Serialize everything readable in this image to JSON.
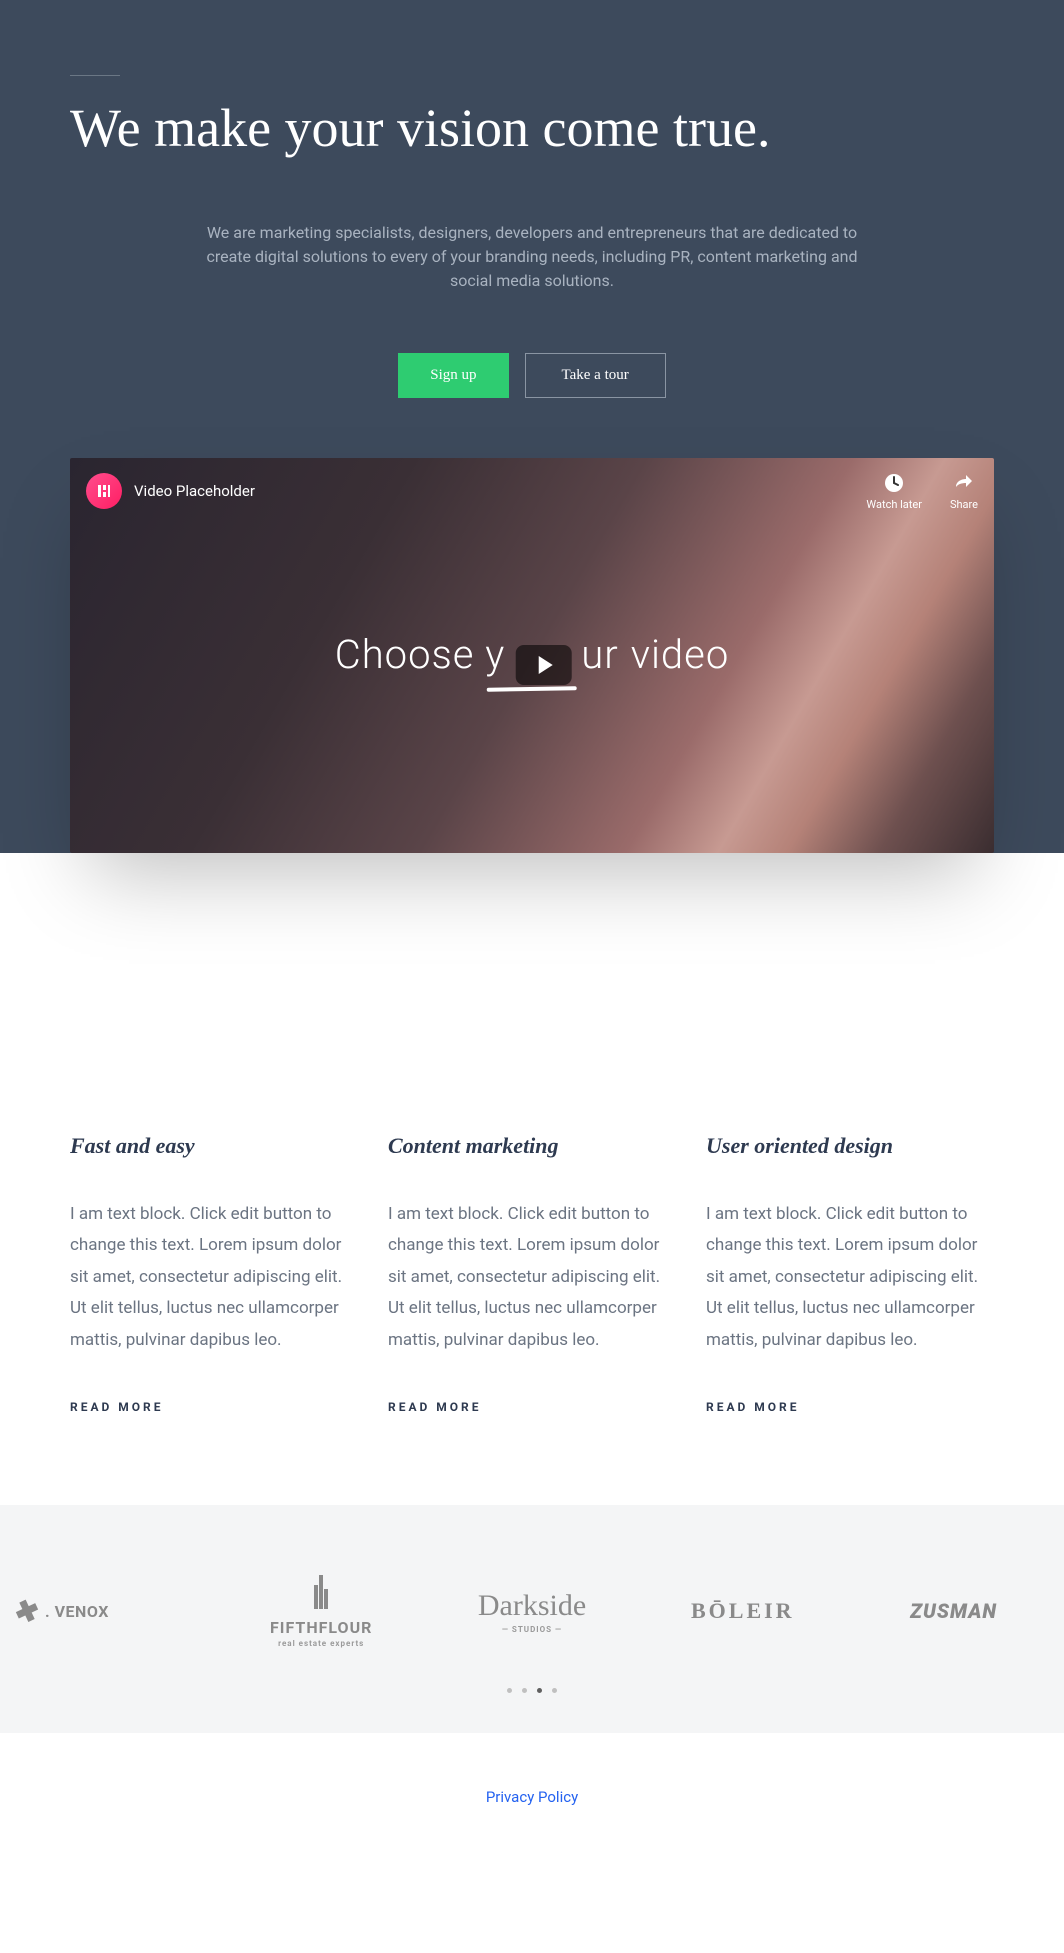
{
  "hero": {
    "title": "We make your vision come true.",
    "subtitle": "We are marketing specialists, designers, developers and entrepreneurs that are dedicated to create digital solutions to every of your branding needs, including PR, content marketing and social media solutions.",
    "signup_label": "Sign up",
    "tour_label": "Take a tour"
  },
  "video": {
    "channel_title": "Video Placeholder",
    "watch_later_label": "Watch later",
    "share_label": "Share",
    "headline_before": "Choose y",
    "headline_mid": "ur",
    "headline_after": "video"
  },
  "features": [
    {
      "title": "Fast and easy",
      "text": "I am text block. Click edit button to change this text. Lorem ipsum dolor sit amet, consectetur adipiscing elit. Ut elit tellus, luctus nec ullamcorper mattis, pulvinar dapibus leo.",
      "link": "READ MORE"
    },
    {
      "title": "Content marketing",
      "text": "I am text block. Click edit button to change this text. Lorem ipsum dolor sit amet, consectetur adipiscing elit. Ut elit tellus, luctus nec ullamcorper mattis, pulvinar dapibus leo.",
      "link": "READ MORE"
    },
    {
      "title": "User oriented design",
      "text": "I am text block. Click edit button to change this text. Lorem ipsum dolor sit amet, consectetur adipiscing elit. Ut elit tellus, luctus nec ullamcorper mattis, pulvinar dapibus leo.",
      "link": "READ MORE"
    }
  ],
  "logos": {
    "venox": ". VENOX",
    "fifth": "FIFTHFLOUR",
    "fifth_sub": "real estate experts",
    "darkside": "Darkside",
    "darkside_sub": "— STUDIOS —",
    "boleir": "BŌLEIR",
    "zusman": "ZUSMAN"
  },
  "footer": {
    "privacy": "Privacy Policy"
  }
}
